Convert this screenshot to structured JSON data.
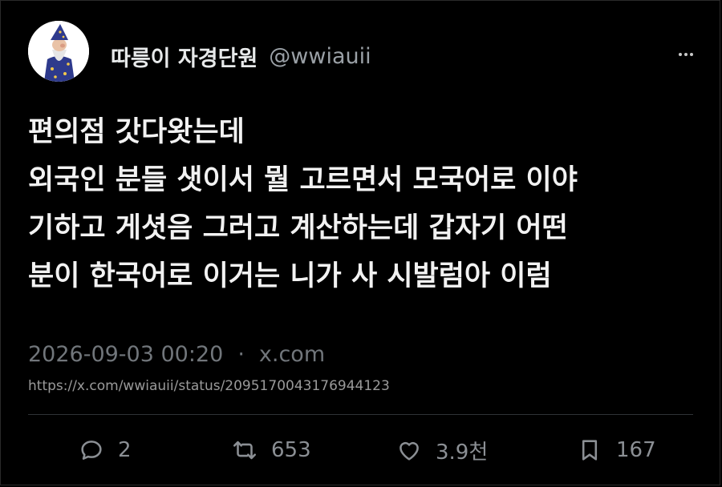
{
  "author": {
    "display_name": "따릉이 자경단원",
    "handle": "@wwiauii",
    "avatar_icon": "wizard-avatar-icon"
  },
  "tweet": {
    "lines": [
      "편의점 갓다왓는데",
      "외국인 분들 샛이서 뭘 고르면서 모국어로 이야",
      "기하고 게셧음 그러고 계산하는데 갑자기 어떤",
      "분이 한국어로 이거는 니가 사 시발럼아 이럼"
    ]
  },
  "meta": {
    "timestamp": "2026-09-03 00:20",
    "separator": "·",
    "source": "x.com",
    "url": "https://x.com/wwiauii/status/2095170043176944123"
  },
  "actions": {
    "reply": {
      "icon": "reply-icon",
      "count": "2"
    },
    "retweet": {
      "icon": "retweet-icon",
      "count": "653"
    },
    "like": {
      "icon": "heart-icon",
      "count": "3.9천"
    },
    "bookmark": {
      "icon": "bookmark-icon",
      "count": "167"
    }
  },
  "colors": {
    "background": "#000000",
    "text": "#e7e9ea",
    "secondary": "#71767b",
    "divider": "#2f3336"
  }
}
